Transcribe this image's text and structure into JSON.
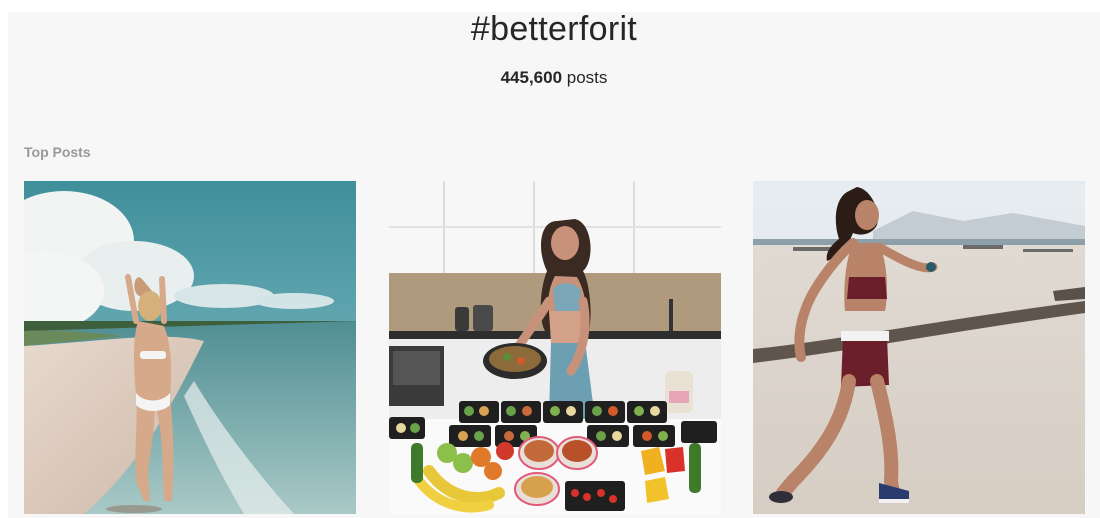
{
  "hashtag": {
    "title": "#betterforit",
    "post_count": "445,600",
    "post_count_suffix": " posts"
  },
  "top_posts": {
    "label": "Top Posts",
    "items": [
      {
        "image_label": "beach-bikini-photo"
      },
      {
        "image_label": "kitchen-meal-prep-photo"
      },
      {
        "image_label": "beach-running-photo"
      }
    ]
  },
  "colors": {
    "background": "#f7f7f7",
    "text": "#262626",
    "section_label": "#999999"
  }
}
